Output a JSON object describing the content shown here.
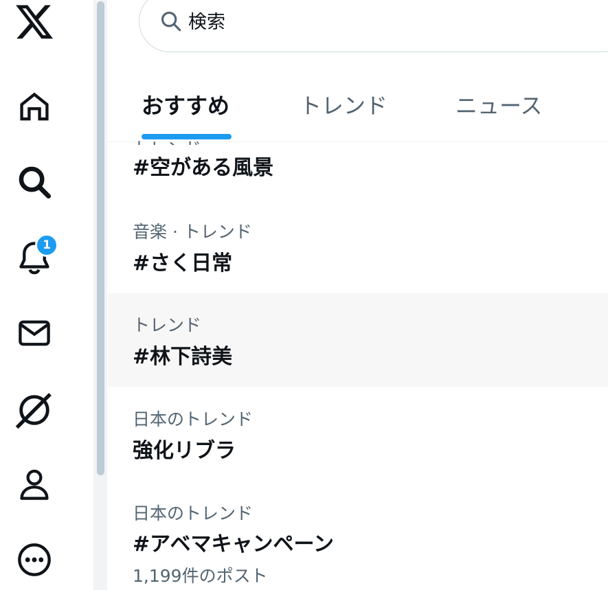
{
  "nav": {
    "items": [
      {
        "name": "x-logo-icon"
      },
      {
        "name": "home-icon"
      },
      {
        "name": "search-icon"
      },
      {
        "name": "notifications-icon"
      },
      {
        "name": "messages-icon"
      },
      {
        "name": "grok-icon"
      },
      {
        "name": "profile-icon"
      },
      {
        "name": "more-icon"
      }
    ],
    "notification_badge": "1"
  },
  "search": {
    "placeholder": "検索"
  },
  "tabs": [
    {
      "label": "おすすめ",
      "active": true
    },
    {
      "label": "トレンド",
      "active": false
    },
    {
      "label": "ニュース",
      "active": false
    }
  ],
  "trends": [
    {
      "meta": "トレンド",
      "title": "#空がある風景"
    },
    {
      "meta": "音楽 · トレンド",
      "title": "#さく日常"
    },
    {
      "meta": "トレンド",
      "title": "#林下詩美"
    },
    {
      "meta": "日本のトレンド",
      "title": "強化リブラ"
    },
    {
      "meta": "日本のトレンド",
      "title": "#アベマキャンペーン",
      "count": "1,199件のポスト"
    }
  ],
  "colors": {
    "accent": "#1d9bf0",
    "text_primary": "#0f1419",
    "text_secondary": "#536471",
    "hover_bg": "#f7f7f7"
  }
}
